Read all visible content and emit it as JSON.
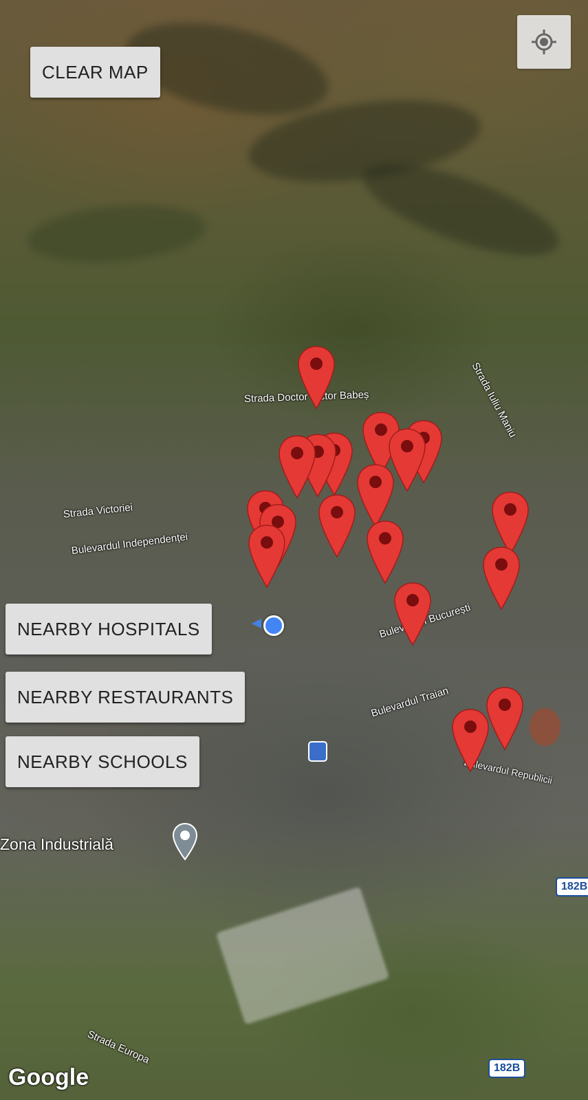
{
  "map": {
    "type": "satellite",
    "provider_logo": "Google",
    "place_label": "Zona Industrială",
    "road_badges": [
      "182B",
      "182B"
    ],
    "streets": [
      "Strada Doctor Victor Babeș",
      "Strada Iuliu Maniu",
      "Strada Victoriei",
      "Bulevardul Independenței",
      "Bulevardul București",
      "Bulevardul Traian",
      "Bulevardul Republicii",
      "Strada Europa"
    ],
    "marker_color": "#e53935",
    "marker_count": 21,
    "user_location_color": "#4285f4"
  },
  "controls": {
    "clear_map": "CLEAR MAP",
    "nearby_hospitals": "NEARBY HOSPITALS",
    "nearby_restaurants": "NEARBY RESTAURANTS",
    "nearby_schools": "NEARBY SCHOOLS",
    "my_location_icon": "crosshair-icon"
  }
}
